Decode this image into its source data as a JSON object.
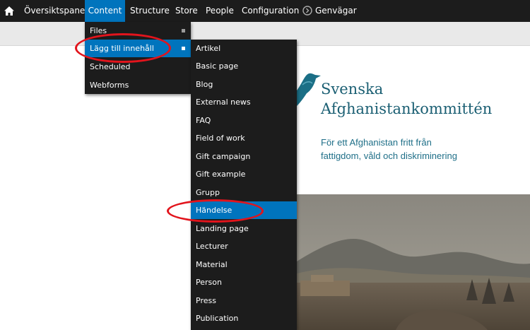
{
  "toolbar": {
    "items": [
      "Översiktspanel",
      "Content",
      "Structure",
      "Store",
      "People",
      "Configuration"
    ],
    "shortcuts": "Genvägar"
  },
  "content_menu": {
    "items": [
      "Files",
      "Lägg till innehåll",
      "Scheduled",
      "Webforms"
    ],
    "highlighted": "Lägg till innehåll"
  },
  "add_content_menu": {
    "items": [
      "Artikel",
      "Basic page",
      "Blog",
      "External news",
      "FAQ",
      "Field of work",
      "Gift campaign",
      "Gift example",
      "Grupp",
      "Händelse",
      "Landing page",
      "Lecturer",
      "Material",
      "Person",
      "Press",
      "Publication"
    ],
    "highlighted": "Händelse"
  },
  "site": {
    "name_line1": "Svenska",
    "name_line2": "Afghanistankommittén",
    "slogan_line1": "För ett Afghanistan fritt från",
    "slogan_line2": "fattigdom, våld och diskriminering"
  },
  "colors": {
    "toolbar": "#1c1c1c",
    "active_blue": "#0074bd",
    "annotation_red": "#e2141c",
    "site_teal": "#1b5f73"
  }
}
